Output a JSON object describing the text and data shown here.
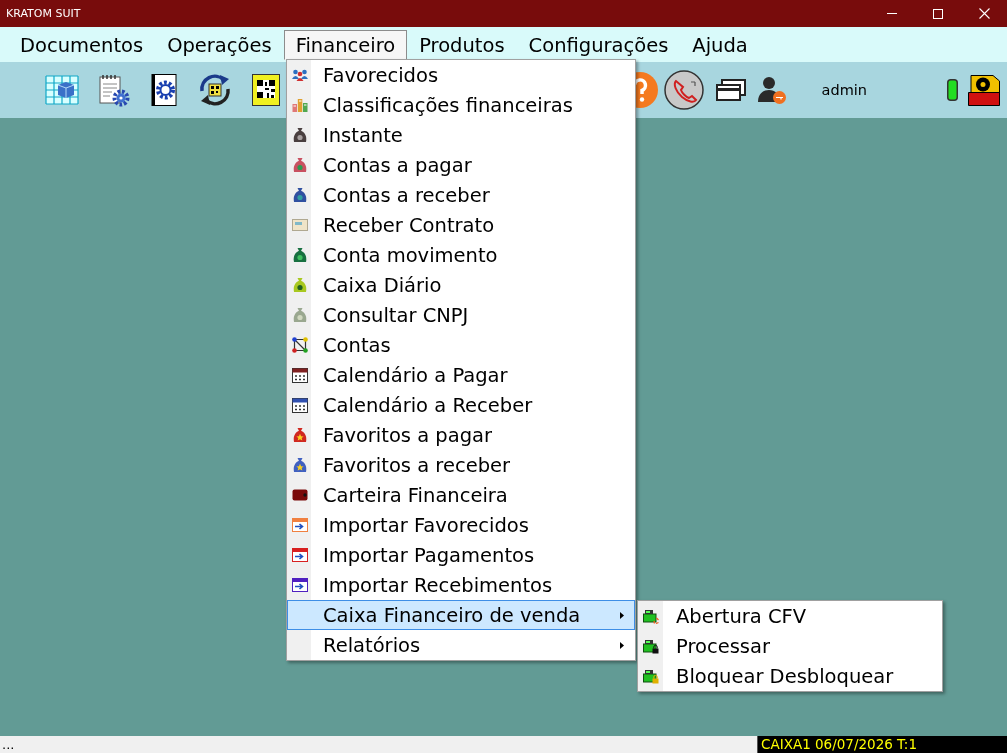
{
  "window": {
    "title": "KRATOM SUIT"
  },
  "menu_bar": [
    {
      "label": "Documentos",
      "selected": false
    },
    {
      "label": "Operações",
      "selected": false
    },
    {
      "label": "Financeiro",
      "selected": true
    },
    {
      "label": "Produtos",
      "selected": false
    },
    {
      "label": "Configurações",
      "selected": false
    },
    {
      "label": "Ajuda",
      "selected": false
    }
  ],
  "toolbar": {
    "user": "admin"
  },
  "financeiro_menu": {
    "items": [
      {
        "label": "Favorecidos",
        "selected": false,
        "has_submenu": false
      },
      {
        "label": "Classificações financeiras",
        "selected": false,
        "has_submenu": false
      },
      {
        "label": "Instante",
        "selected": false,
        "has_submenu": false
      },
      {
        "label": "Contas a pagar",
        "selected": false,
        "has_submenu": false
      },
      {
        "label": "Contas a receber",
        "selected": false,
        "has_submenu": false
      },
      {
        "label": "Receber Contrato",
        "selected": false,
        "has_submenu": false
      },
      {
        "label": "Conta movimento",
        "selected": false,
        "has_submenu": false
      },
      {
        "label": "Caixa Diário",
        "selected": false,
        "has_submenu": false
      },
      {
        "label": "Consultar CNPJ",
        "selected": false,
        "has_submenu": false
      },
      {
        "label": "Contas",
        "selected": false,
        "has_submenu": false
      },
      {
        "label": "Calendário a Pagar",
        "selected": false,
        "has_submenu": false
      },
      {
        "label": "Calendário a Receber",
        "selected": false,
        "has_submenu": false
      },
      {
        "label": "Favoritos a pagar",
        "selected": false,
        "has_submenu": false
      },
      {
        "label": "Favoritos a receber",
        "selected": false,
        "has_submenu": false
      },
      {
        "label": "Carteira Financeira",
        "selected": false,
        "has_submenu": false
      },
      {
        "label": "Importar Favorecidos",
        "selected": false,
        "has_submenu": false
      },
      {
        "label": "Importar Pagamentos",
        "selected": false,
        "has_submenu": false
      },
      {
        "label": "Importar Recebimentos",
        "selected": false,
        "has_submenu": false
      },
      {
        "label": "Caixa Financeiro de venda",
        "selected": true,
        "has_submenu": true
      },
      {
        "label": "Relatórios",
        "selected": false,
        "has_submenu": true
      }
    ]
  },
  "submenu": {
    "items": [
      {
        "label": "Abertura CFV",
        "selected": false
      },
      {
        "label": "Processar",
        "selected": false
      },
      {
        "label": "Bloquear Desbloquear",
        "selected": false
      }
    ]
  },
  "status_bar": {
    "text": "...",
    "session": "CAIXA1 06/07/2026 T:1"
  }
}
